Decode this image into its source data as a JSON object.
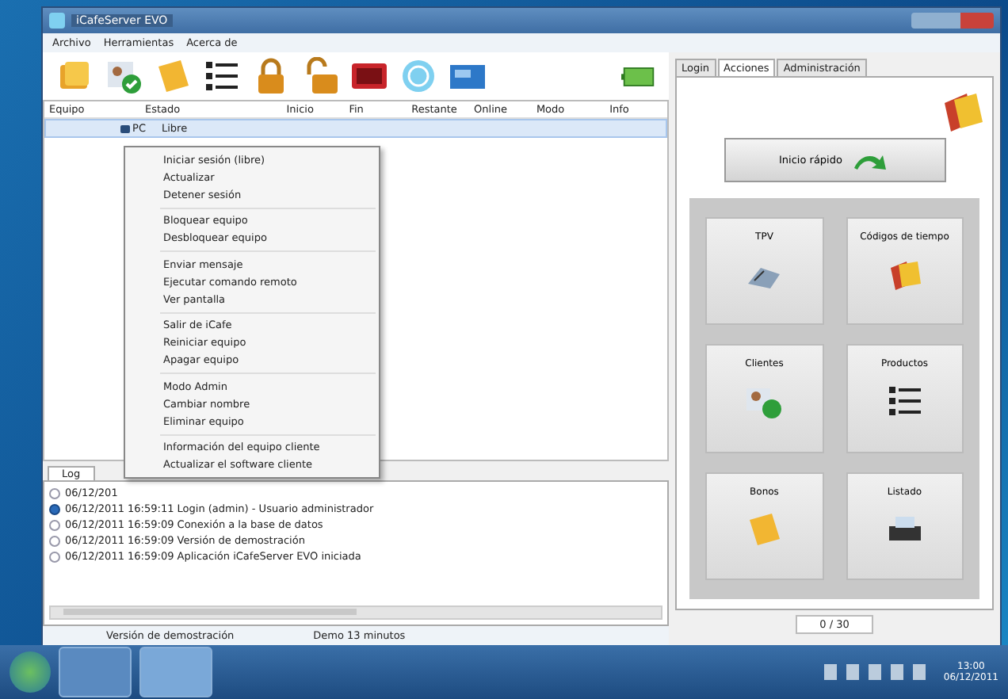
{
  "window": {
    "title": "iCafeServer EVO"
  },
  "menu": [
    "Archivo",
    "Herramientas",
    "Acerca de"
  ],
  "table": {
    "columns": [
      "Equipo",
      "Estado",
      "Inicio",
      "Fin",
      "Restante",
      "Online",
      "Modo",
      "Info"
    ],
    "rows": [
      {
        "cells": [
          "PC",
          "Libre"
        ],
        "selected": true
      }
    ]
  },
  "context_menu": {
    "groups": [
      [
        "Iniciar sesión (libre)",
        "Actualizar",
        "Detener sesión"
      ],
      [
        "Bloquear equipo",
        "Desbloquear equipo"
      ],
      [
        "Enviar mensaje",
        "Ejecutar comando remoto",
        "Ver pantalla"
      ],
      [
        "Salir de iCafe",
        "Reiniciar equipo",
        "Apagar equipo"
      ],
      [
        "Modo Admin",
        "Cambiar nombre",
        "Eliminar equipo"
      ],
      [
        "Información del equipo cliente",
        "Actualizar el software cliente"
      ]
    ]
  },
  "log": {
    "tab": "Log",
    "entries": [
      {
        "kind": "plain",
        "text": "06/12/201"
      },
      {
        "kind": "info",
        "text": "06/12/2011 16:59:11   Login (admin) - Usuario administrador"
      },
      {
        "kind": "plain",
        "text": "06/12/2011 16:59:09   Conexión a la base de datos"
      },
      {
        "kind": "plain",
        "text": "06/12/2011 16:59:09   Versión de demostración"
      },
      {
        "kind": "plain",
        "text": "06/12/2011 16:59:09   Aplicación iCafeServer EVO iniciada"
      }
    ]
  },
  "status_bar": [
    "Versión de demostración",
    "Demo 13 minutos"
  ],
  "side_panel": {
    "tabs": [
      {
        "label": "Login",
        "selected": false
      },
      {
        "label": "Acciones",
        "selected": true
      },
      {
        "label": "Administración",
        "selected": false
      }
    ],
    "quick_button": "Inicio rápido",
    "tiles": [
      {
        "label": "TPV",
        "kind": "register"
      },
      {
        "label": "Códigos de tiempo",
        "kind": "codes"
      },
      {
        "label": "Clientes",
        "kind": "clients"
      },
      {
        "label": "Productos",
        "kind": "list"
      },
      {
        "label": "Bonos",
        "kind": "note"
      },
      {
        "label": "Listado",
        "kind": "printer"
      }
    ],
    "counter": "0 / 30"
  },
  "taskbar": {
    "time": "13:00",
    "date": "06/12/2011"
  }
}
